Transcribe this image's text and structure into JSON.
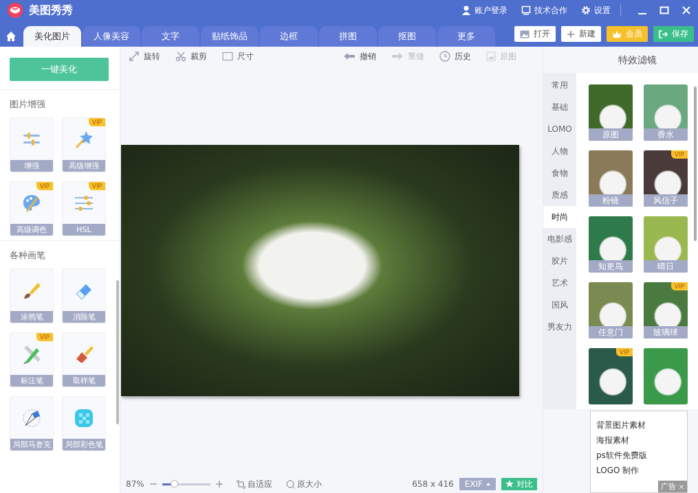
{
  "app": {
    "title": "美图秀秀",
    "links": [
      {
        "kind": "user",
        "label": "账户登录"
      },
      {
        "kind": "monitor",
        "label": "技术合作"
      },
      {
        "kind": "gear",
        "label": "设置"
      }
    ]
  },
  "tabs": [
    {
      "label": "美化图片",
      "selected": true
    },
    {
      "label": "人像美容",
      "selected": false
    },
    {
      "label": "文字",
      "selected": false
    },
    {
      "label": "贴纸饰品",
      "selected": false
    },
    {
      "label": "边框",
      "selected": false
    },
    {
      "label": "拼图",
      "selected": false
    },
    {
      "label": "抠图",
      "selected": false
    },
    {
      "label": "更多",
      "selected": false
    }
  ],
  "actions": [
    {
      "kind": "open",
      "label": "打开"
    },
    {
      "kind": "new",
      "label": "新建"
    },
    {
      "kind": "vip",
      "label": "会员"
    },
    {
      "kind": "save",
      "label": "保存"
    }
  ],
  "sidebar": {
    "button": "一键美化",
    "sections": [
      {
        "title": "图片增强",
        "tools": [
          {
            "kind": "sliders",
            "label": "增强"
          },
          {
            "kind": "wand",
            "label": "高级增强",
            "badge": "VIP"
          },
          {
            "kind": "palette",
            "label": "高级调色",
            "badge": "VIP"
          },
          {
            "kind": "hsl",
            "label": "HSL",
            "badge": "VIP"
          }
        ]
      },
      {
        "title": "各种画笔",
        "tools": [
          {
            "kind": "brush",
            "label": "涂鸦笔"
          },
          {
            "kind": "eraser",
            "label": "消除笔"
          },
          {
            "kind": "ruler",
            "label": "标注笔",
            "badge": "VIP"
          },
          {
            "kind": "paint",
            "label": "取样笔"
          },
          {
            "kind": "pen",
            "label": "局部马赛克"
          },
          {
            "kind": "checker",
            "label": "局部彩色笔"
          }
        ]
      }
    ]
  },
  "toolbar": [
    {
      "kind": "rotate",
      "label": "旋转",
      "disabled": false
    },
    {
      "kind": "crop",
      "label": "裁剪",
      "disabled": false
    },
    {
      "kind": "size",
      "label": "尺寸",
      "disabled": false
    },
    {
      "kind": "undo",
      "label": "撤销",
      "disabled": false
    },
    {
      "kind": "redo",
      "label": "重做",
      "disabled": true
    },
    {
      "kind": "history",
      "label": "历史",
      "disabled": false
    },
    {
      "kind": "original",
      "label": "原图",
      "disabled": true
    }
  ],
  "status_bar": {
    "zoom": "87%",
    "zoom_slider": {
      "level": 0.25
    },
    "fit": "自适应",
    "actual": "原大小",
    "dimensions": "658 x 416",
    "exif": "EXIF",
    "compare": "对比"
  },
  "filters": {
    "title": "特效滤镜",
    "categories": [
      {
        "label": "常用",
        "selected": false
      },
      {
        "label": "基础",
        "selected": false
      },
      {
        "label": "LOMO",
        "selected": false
      },
      {
        "label": "人物",
        "selected": false
      },
      {
        "label": "食物",
        "selected": false
      },
      {
        "label": "质感",
        "selected": false
      },
      {
        "label": "时尚",
        "selected": true
      },
      {
        "label": "电影感",
        "selected": false
      },
      {
        "label": "胶片",
        "selected": false
      },
      {
        "label": "艺术",
        "selected": false
      },
      {
        "label": "国风",
        "selected": false
      },
      {
        "label": "男友力",
        "selected": false
      }
    ],
    "items": [
      {
        "label": "原图",
        "color": "#3f6a2a"
      },
      {
        "label": "香水",
        "color": "#6aa880"
      },
      {
        "label": "粉镜",
        "color": "#8a7a5a"
      },
      {
        "label": "风信子",
        "badge": "VIP",
        "color": "#4a3a3a"
      },
      {
        "label": "知更鸟",
        "color": "#2f7a4a"
      },
      {
        "label": "晴日",
        "color": "#9ab850"
      },
      {
        "label": "任意门",
        "color": "#7a8a50"
      },
      {
        "label": "玻璃球",
        "badge": "VIP",
        "color": "#4a7a40"
      },
      {
        "badge": "VIP",
        "color": "#2a5a4a"
      },
      {
        "color": "#3a9a4a"
      }
    ]
  },
  "ad": {
    "items": [
      "背景图片素材",
      "海报素材",
      "ps软件免费版",
      "LOGO 制作"
    ],
    "tag": "广告"
  }
}
